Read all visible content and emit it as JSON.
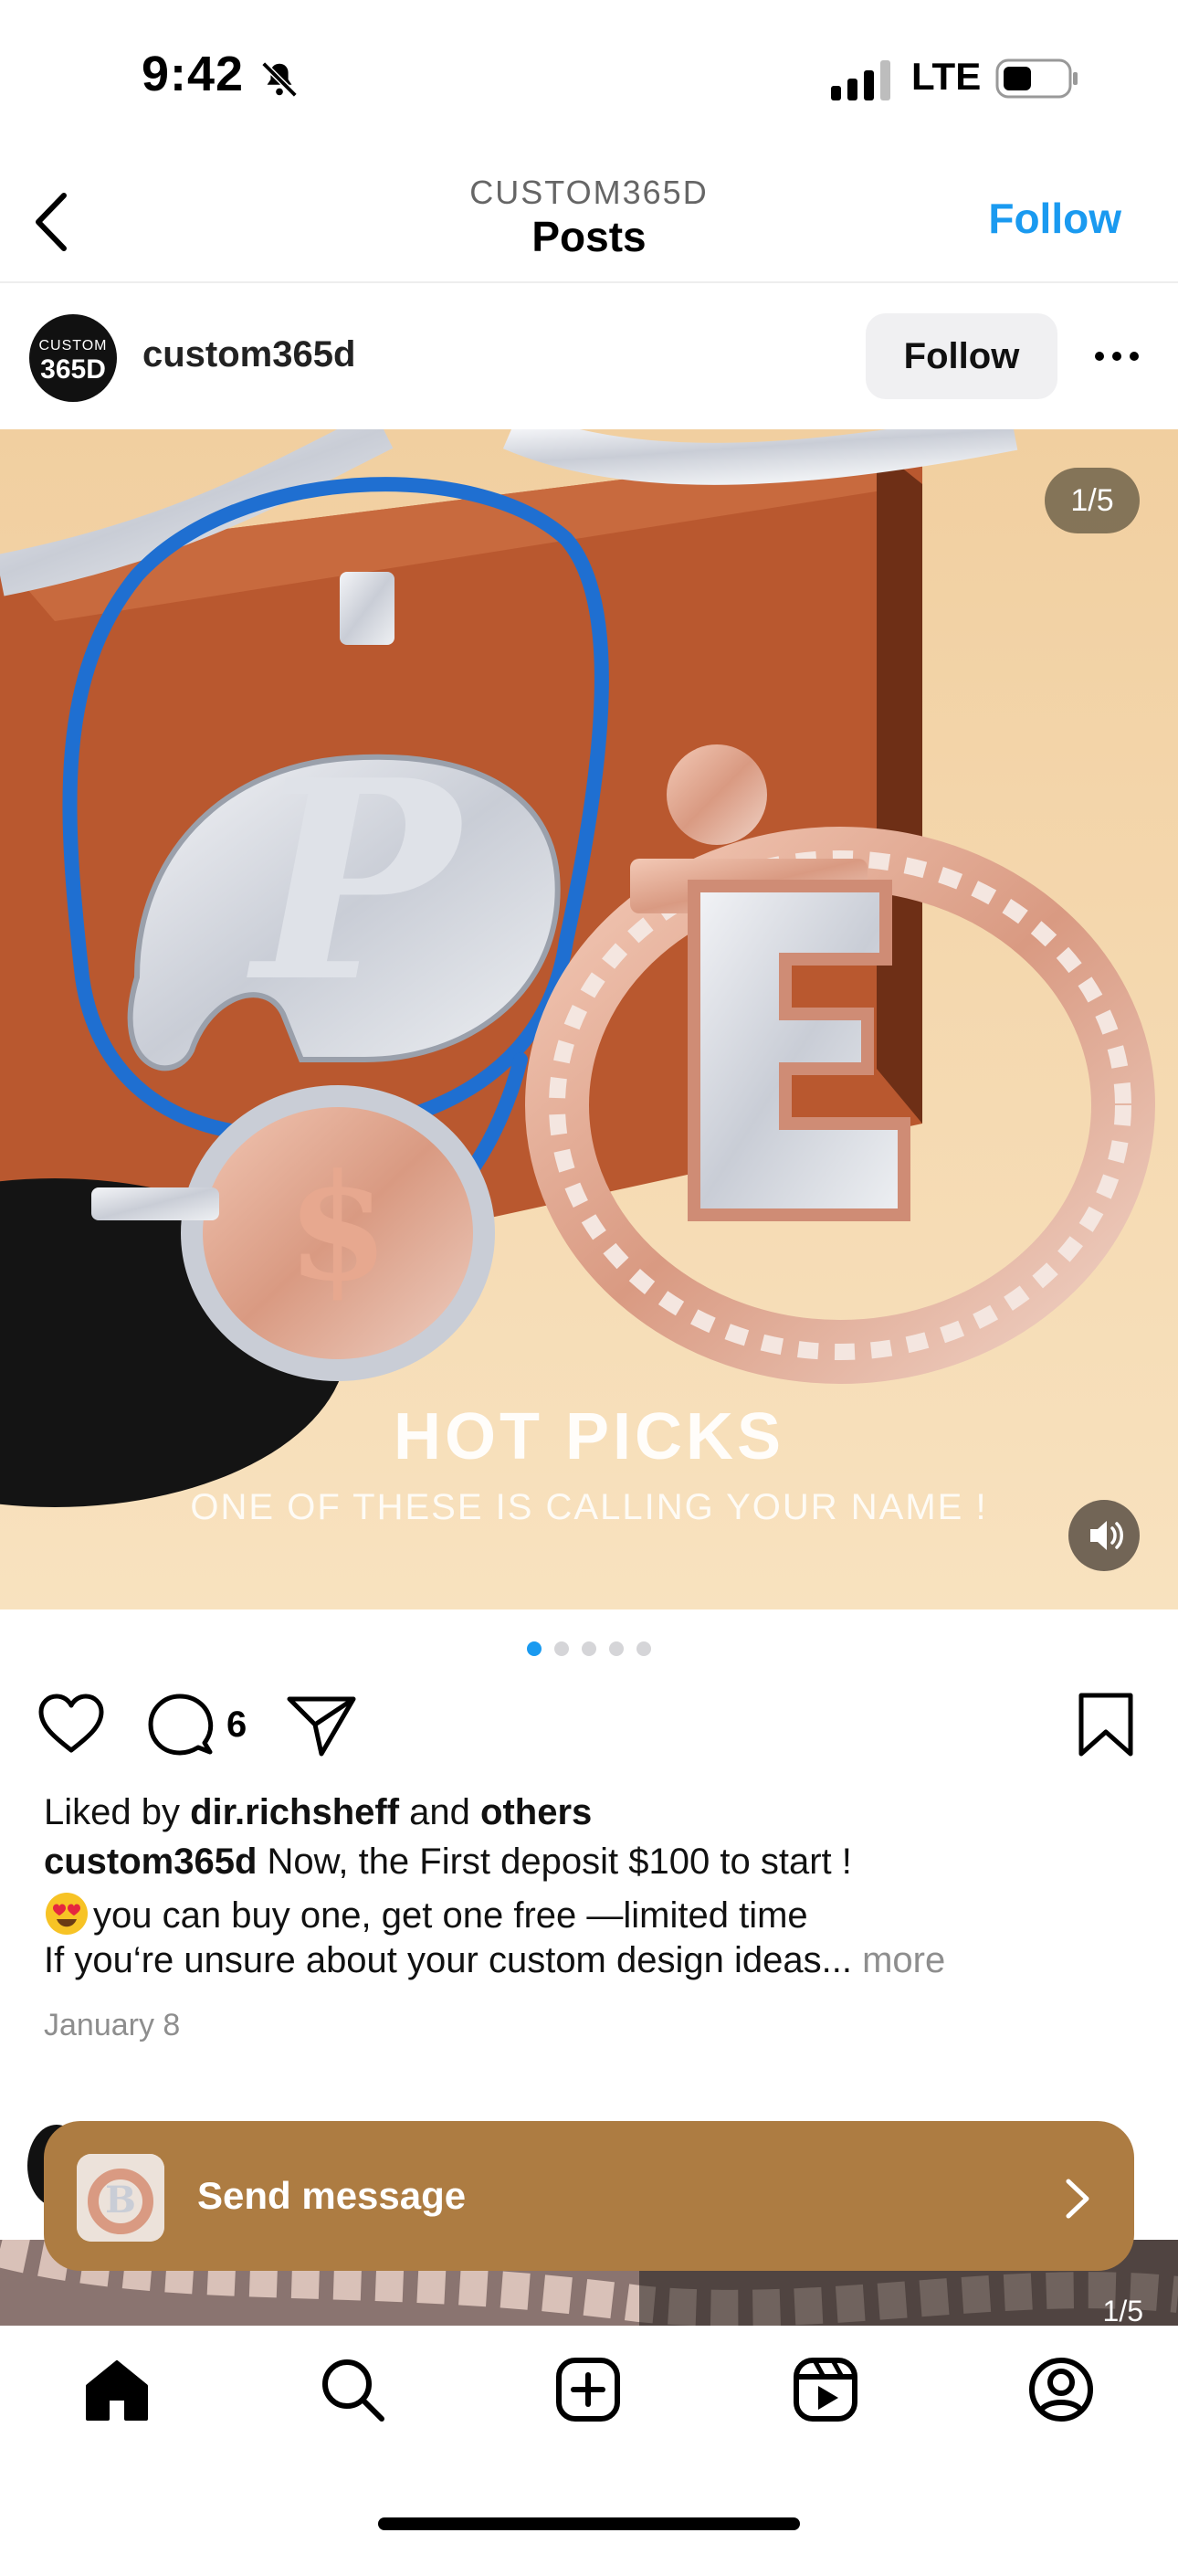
{
  "status_bar": {
    "time": "9:42",
    "network": "LTE"
  },
  "nav": {
    "subtitle": "CUSTOM365D",
    "title": "Posts",
    "follow_label": "Follow"
  },
  "post": {
    "avatar_text_top": "CUSTOM",
    "avatar_text_main": "365D",
    "username": "custom365d",
    "follow_label": "Follow",
    "image_counter": "1/5",
    "image_title": "HOT PICKS",
    "image_subtitle": "ONE OF THESE IS CALLING YOUR NAME !",
    "carousel": {
      "total": 5,
      "active_index": 0
    },
    "comment_count": "6",
    "liked_prefix": "Liked by ",
    "liked_user": "dir.richsheff",
    "liked_and": " and ",
    "liked_others": "others",
    "caption_user": "custom365d",
    "caption_line1": " Now, the First deposit $100 to start !",
    "caption_line2": "you can buy one, get one free —limited time",
    "caption_line3": "If you‘re unsure about your custom design ideas...",
    "caption_more": " more",
    "date": "January 8"
  },
  "send_message": {
    "label": "Send message"
  },
  "next_post": {
    "image_counter": "1/5"
  },
  "colors": {
    "accent": "#1a9af0",
    "banner": "#ad7c42"
  },
  "icons": [
    "bell-slash-icon",
    "signal-icon",
    "battery-icon",
    "back-chevron-icon",
    "more-dots-icon",
    "speaker-icon",
    "heart-icon",
    "comment-icon",
    "share-icon",
    "bookmark-icon",
    "chevron-right-icon",
    "home-icon",
    "search-icon",
    "create-icon",
    "reels-icon",
    "profile-icon"
  ]
}
